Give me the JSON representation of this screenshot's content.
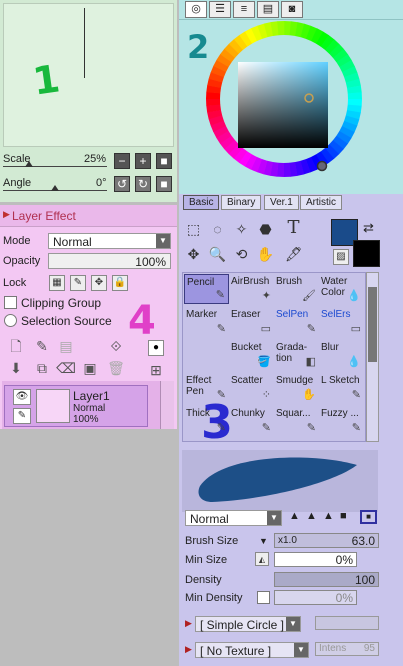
{
  "annotations": {
    "n1": "1",
    "n2": "2",
    "n3": "3",
    "n4": "4"
  },
  "navigator": {
    "scale_label": "Scale",
    "scale_value": "25%",
    "scale_level_pct": 25,
    "angle_label": "Angle",
    "angle_value": "0°",
    "angle_level_pct": 50
  },
  "layer_panel": {
    "header": "Layer Effect",
    "mode_label": "Mode",
    "mode_value": "Normal",
    "opacity_label": "Opacity",
    "opacity_value": "100%",
    "lock_label": "Lock",
    "clipping_label": "Clipping Group",
    "selection_source_label": "Selection Source",
    "layers": [
      {
        "name": "Layer1",
        "mode": "Normal",
        "opacity": "100%"
      }
    ]
  },
  "color_panel": {
    "tab_icons": [
      "color-wheel-icon",
      "sliders-icon",
      "hsv-sliders-icon",
      "swatches-icon",
      "scratchpad-icon"
    ],
    "colors": {
      "primary": "#1a4b8a",
      "secondary": "#000000"
    }
  },
  "tool_panel": {
    "tabs": [
      "Basic",
      "Binary",
      "Ver.1",
      "Artistic"
    ],
    "active_tab": "Basic",
    "brushes": [
      [
        "Pencil",
        "AirBrush",
        "Brush",
        "Water Color"
      ],
      [
        "Marker",
        "Eraser",
        "SelPen",
        "SelErs"
      ],
      [
        "",
        "Bucket",
        "Grada- tion",
        "Blur"
      ],
      [
        "Effect Pen",
        "Scatter",
        "Smudge",
        "L Sketch"
      ],
      [
        "Thick",
        "Chunky",
        "Squar...",
        "Fuzzy ..."
      ]
    ],
    "blend_mode": "Normal",
    "brush_size_label": "Brush Size",
    "brush_multiplier": "x1.0",
    "brush_size_value": "63.0",
    "min_size_label": "Min Size",
    "min_size_value": "0%",
    "density_label": "Density",
    "density_value": "100",
    "min_density_label": "Min Density",
    "min_density_value": "0%",
    "shape_label": "[ Simple Circle ]",
    "texture_label": "[ No Texture ]",
    "intens_label": "Intens",
    "intens_value": "95"
  }
}
